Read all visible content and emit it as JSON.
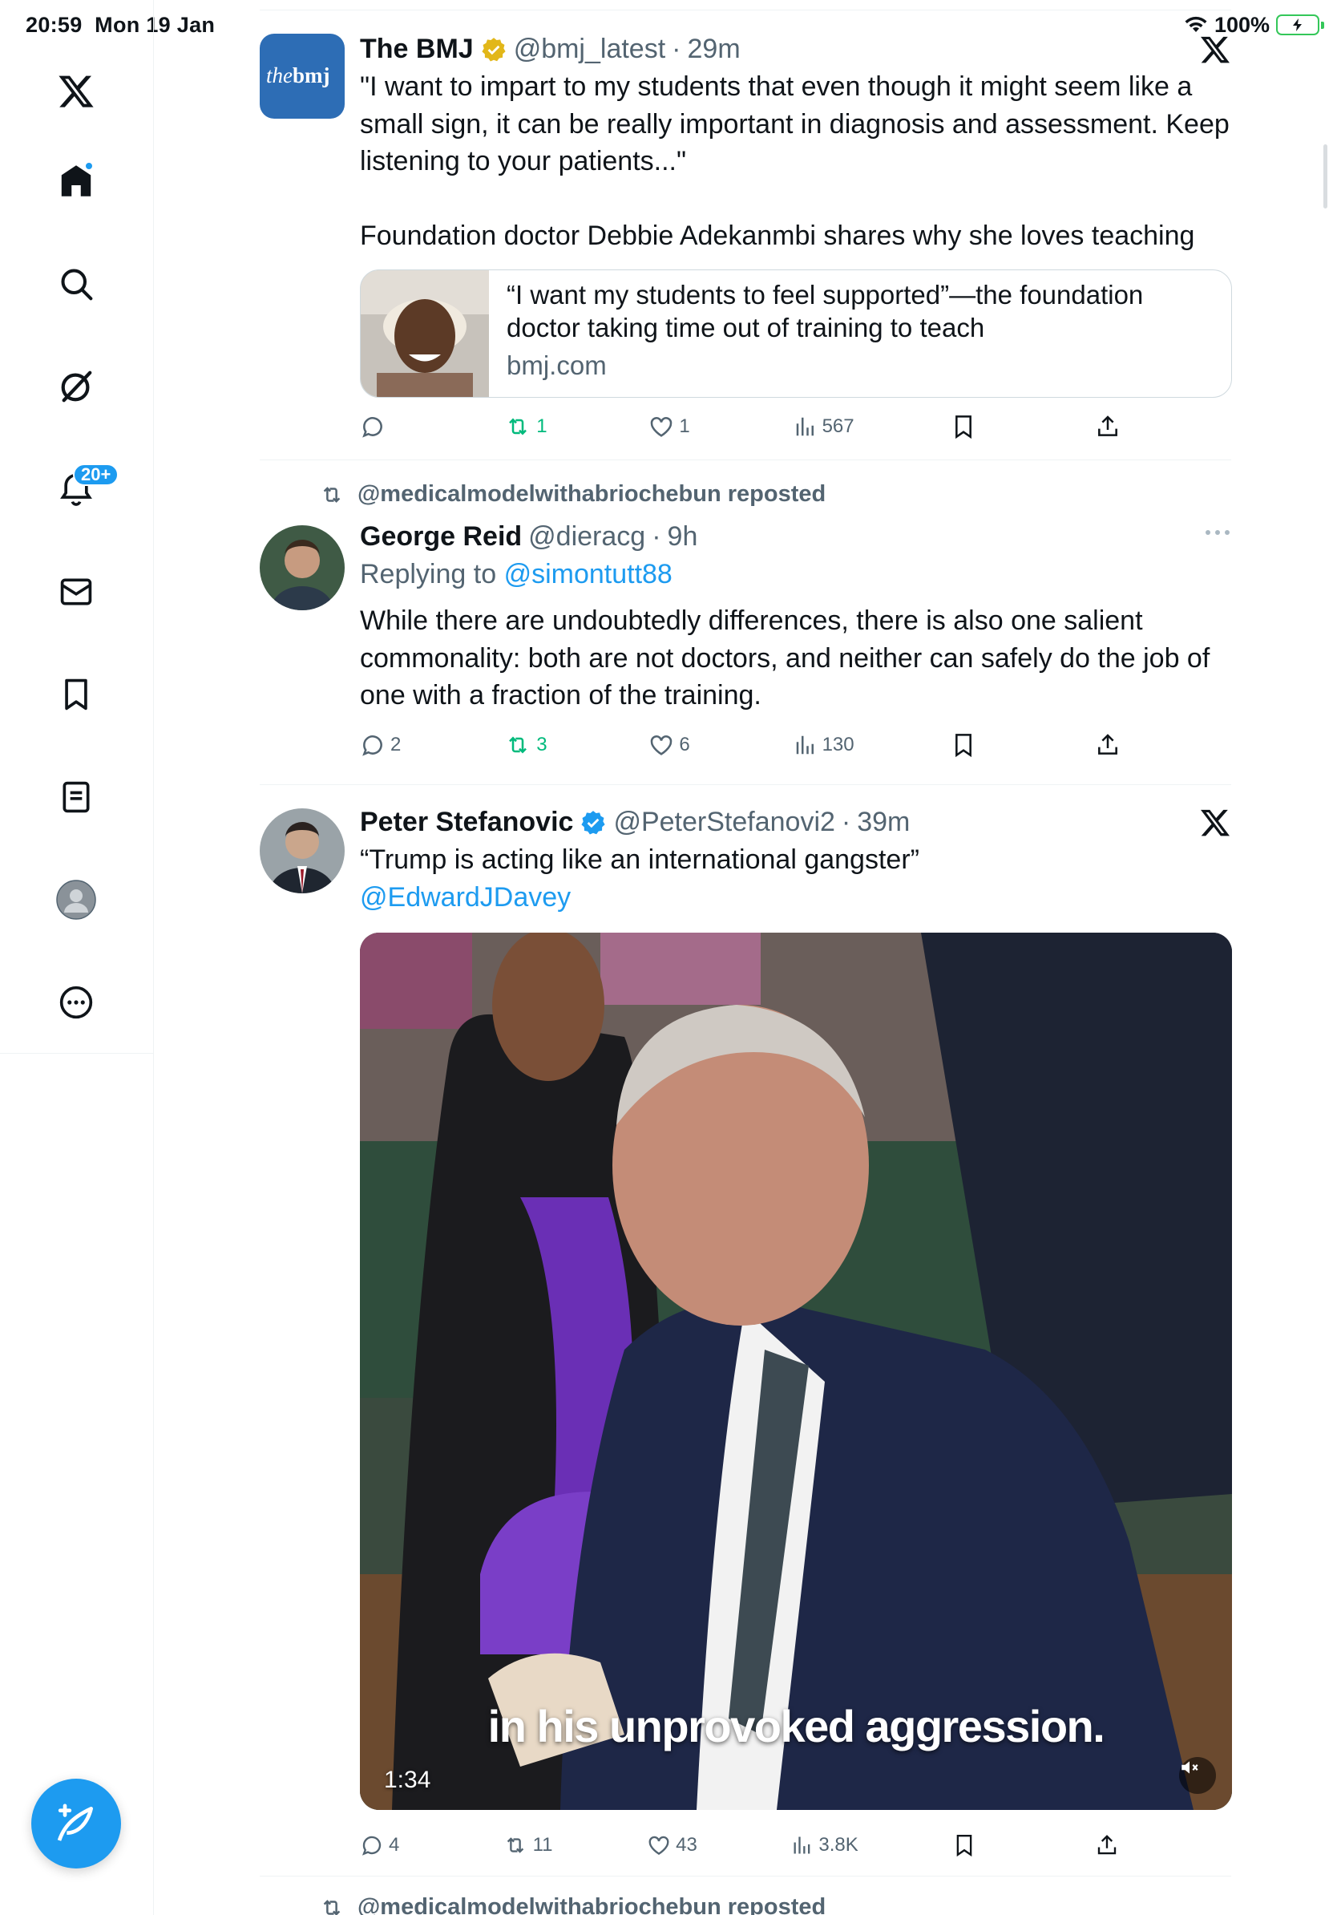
{
  "status_bar": {
    "time": "20:59",
    "date": "Mon 19 Jan",
    "battery": "100%",
    "battery_charging": true
  },
  "sidebar": {
    "items": [
      {
        "name": "home",
        "active": true,
        "has_dot": true
      },
      {
        "name": "explore"
      },
      {
        "name": "grok"
      },
      {
        "name": "notifications",
        "badge": "20+"
      },
      {
        "name": "messages"
      },
      {
        "name": "bookmarks"
      },
      {
        "name": "lists"
      },
      {
        "name": "profile"
      },
      {
        "name": "more"
      }
    ],
    "compose_icon": "compose-feather-plus-icon"
  },
  "tweets": [
    {
      "author": "The BMJ",
      "verified": "gold",
      "handle": "@bmj_latest",
      "time": "29m",
      "avatar_text_1": "the",
      "avatar_text_2": "bmj",
      "text_lines": [
        "\"I want to impart to my students that even though it might seem like a",
        "small sign, it can be really important in diagnosis and assessment. Keep",
        "listening to your patients...\""
      ],
      "text_line_2": "Foundation doctor Debbie Adekanmbi shares why she loves teaching",
      "card": {
        "title_line_1": "“I want my students to feel supported”—the foundation",
        "title_line_2": "doctor taking time out of training to teach",
        "domain": "bmj.com"
      },
      "stats": {
        "replies": "",
        "reposts": "1",
        "likes": "1",
        "views": "567"
      }
    },
    {
      "reposted_by": "@medicalmodelwithabriochebun reposted",
      "author": "George Reid",
      "handle": "@dieracg",
      "time": "9h",
      "replying_prefix": "Replying to",
      "replying_to": "@simontutt88",
      "text_lines": [
        "While there are undoubtedly differences, there is also one salient",
        "commonality: both are not doctors, and neither can safely do the job of",
        "one with a fraction of the training."
      ],
      "stats": {
        "replies": "2",
        "reposts": "3",
        "likes": "6",
        "views": "130"
      }
    },
    {
      "author": "Peter Stefanovic",
      "verified": "blue",
      "handle": "@PeterStefanovi2",
      "time": "39m",
      "text": "“Trump is acting like an international gangster”",
      "mention": "@EdwardJDavey",
      "video": {
        "caption": "in his unprovoked aggression.",
        "duration": "1:34",
        "muted": true
      },
      "stats": {
        "replies": "4",
        "reposts": "11",
        "likes": "43",
        "views": "3.8K"
      }
    }
  ],
  "next_repost_line": "@medicalmodelwithabriochebun reposted",
  "colors": {
    "accent": "#1d9bf0",
    "repost_green": "#00ba7c",
    "muted_text": "#536471",
    "divider": "#eff3f4",
    "bmj_blue": "#2d6db5",
    "gold_badge": "#e2b719"
  }
}
